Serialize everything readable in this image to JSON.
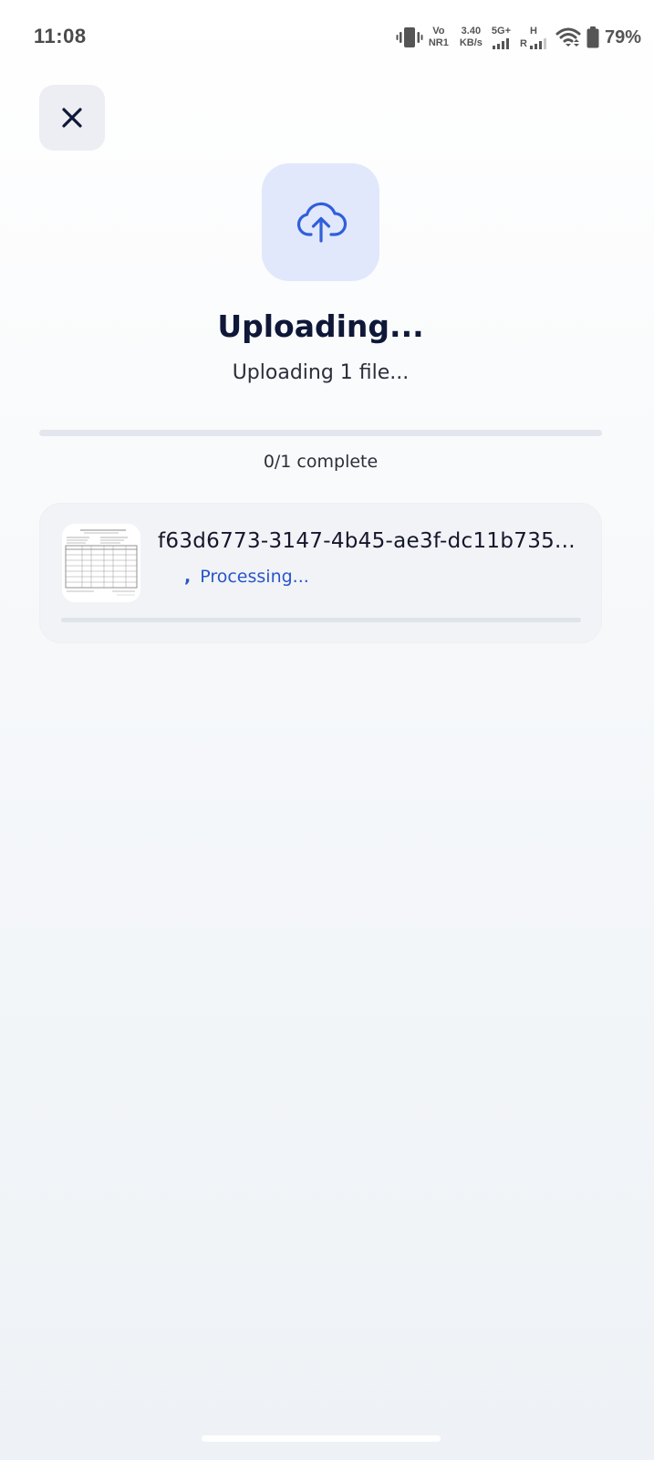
{
  "status_bar": {
    "time": "11:08",
    "volte_top": "Vo",
    "volte_bottom": "NR1",
    "speed_value": "3.40",
    "speed_unit": "KB/s",
    "network_label": "5G+",
    "network2_label": "H",
    "roaming_label": "R",
    "battery_percent": "79%"
  },
  "close_button": {
    "icon": "close-icon"
  },
  "upload": {
    "icon": "cloud-upload-icon",
    "title": "Uploading...",
    "subtitle": "Uploading 1 file...",
    "progress_text": "0/1 complete",
    "progress_fraction": 0
  },
  "file": {
    "name": "f63d6773-3147-4b45-ae3f-dc11b735...",
    "status_prefix": ",",
    "status": "Processing...",
    "progress_fraction": 0
  },
  "colors": {
    "accent": "#2f5fdb",
    "title": "#0f1838",
    "status_text": "#2a55c9",
    "icon_bg": "#e2e8fb"
  }
}
